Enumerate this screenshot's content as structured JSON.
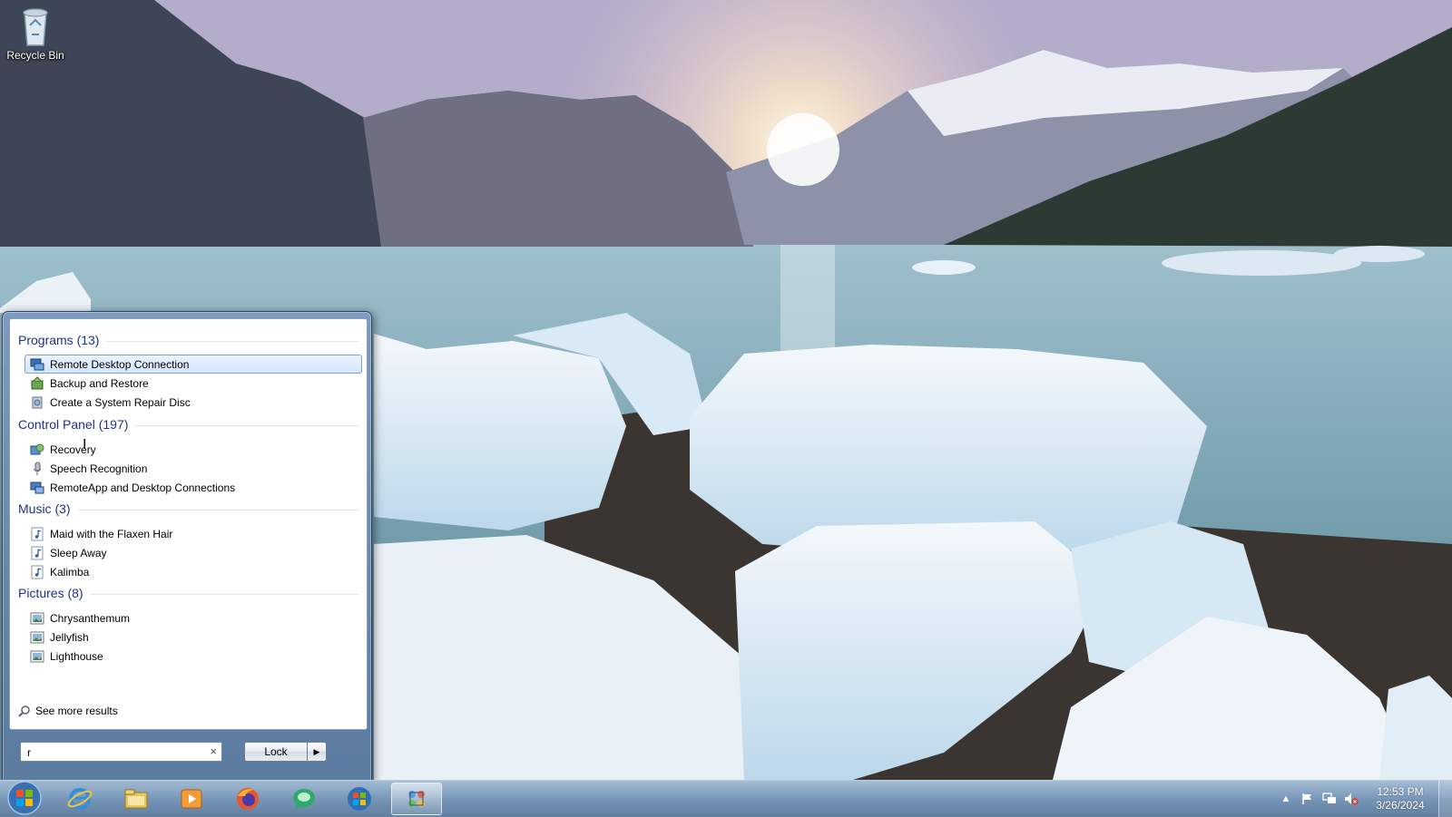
{
  "desktop": {
    "icons": [
      {
        "label": "Recycle Bin",
        "icon": "recycle-bin-icon"
      }
    ]
  },
  "start_menu": {
    "groups": [
      {
        "header": "Programs (13)",
        "items": [
          {
            "label": "Remote Desktop Connection",
            "icon": "remote-desktop-icon",
            "selected": true
          },
          {
            "label": "Backup and Restore",
            "icon": "backup-restore-icon"
          },
          {
            "label": "Create a System Repair Disc",
            "icon": "repair-disc-icon"
          }
        ]
      },
      {
        "header": "Control Panel (197)",
        "items": [
          {
            "label": "Recovery",
            "icon": "recovery-icon"
          },
          {
            "label": "Speech Recognition",
            "icon": "microphone-icon"
          },
          {
            "label": "RemoteApp and Desktop Connections",
            "icon": "remoteapp-icon"
          }
        ]
      },
      {
        "header": "Music (3)",
        "items": [
          {
            "label": "Maid with the Flaxen Hair",
            "icon": "music-file-icon"
          },
          {
            "label": "Sleep Away",
            "icon": "music-file-icon"
          },
          {
            "label": "Kalimba",
            "icon": "music-file-icon"
          }
        ]
      },
      {
        "header": "Pictures (8)",
        "items": [
          {
            "label": "Chrysanthemum",
            "icon": "picture-file-icon"
          },
          {
            "label": "Jellyfish",
            "icon": "picture-file-icon"
          },
          {
            "label": "Lighthouse",
            "icon": "picture-file-icon"
          }
        ]
      }
    ],
    "see_more": "See more results",
    "search": {
      "value": "r",
      "clear": "×"
    },
    "power": {
      "label": "Lock",
      "arrow": "▶"
    }
  },
  "taskbar": {
    "pinned": [
      "internet-explorer-icon",
      "file-explorer-icon",
      "media-player-icon",
      "firefox-icon",
      "chat-app-icon",
      "windows-update-icon",
      "remote-desktop-app-icon"
    ],
    "active": "remote-desktop-app-icon"
  },
  "tray": {
    "time": "12:53 PM",
    "date": "3/26/2024",
    "icons": [
      "show-hidden-icons-arrow",
      "action-center-flag-icon",
      "network-icon",
      "volume-muted-icon"
    ]
  },
  "colors": {
    "header": "#1e3287",
    "selection": "#d4e6fb"
  }
}
